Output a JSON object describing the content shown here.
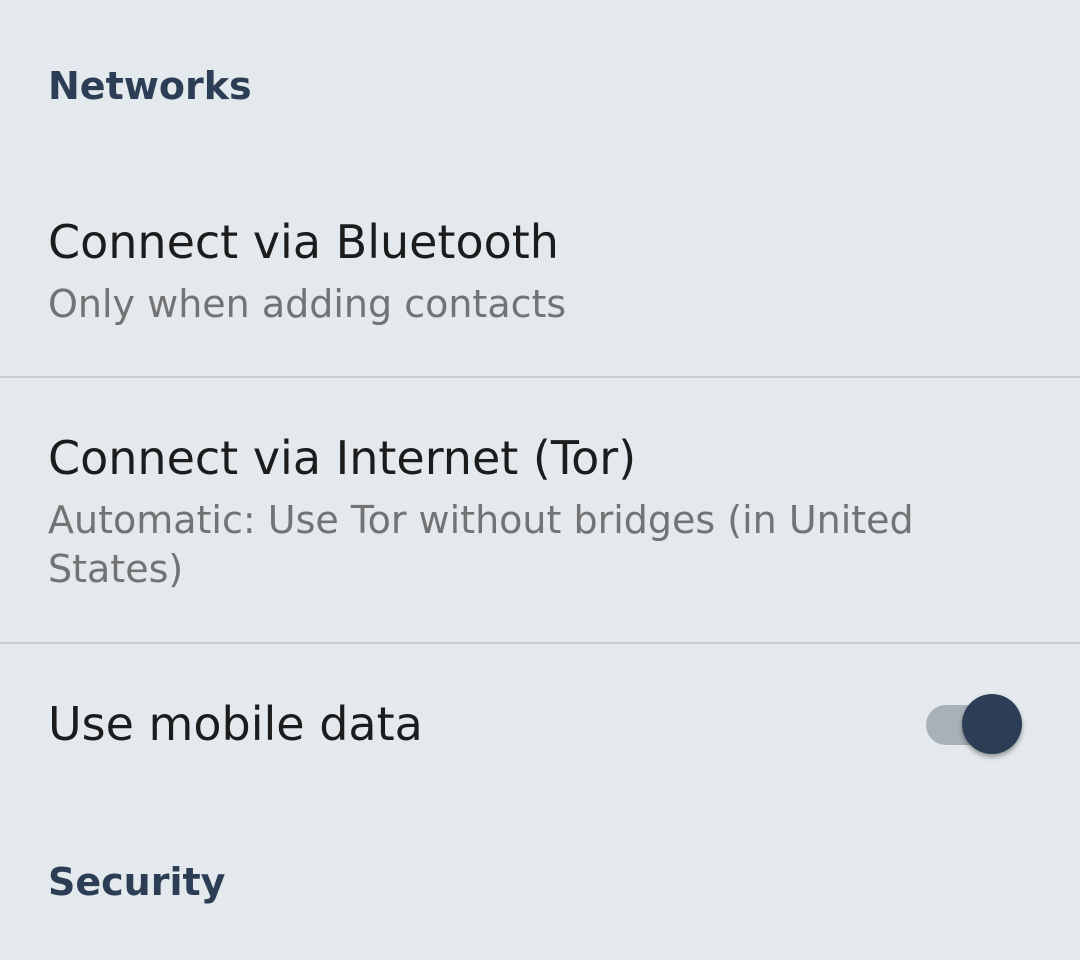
{
  "colors": {
    "background": "#e3e9ec",
    "category_text": "#2c3e55",
    "title_text": "#1c1c1c",
    "summary_text": "#737373",
    "divider": "#c6cccf",
    "switch_thumb": "#2c3e55",
    "switch_track": "#a8b1b9"
  },
  "sections": {
    "networks": {
      "title": "Networks",
      "items": {
        "bluetooth": {
          "title": "Connect via Bluetooth",
          "summary": "Only when adding contacts"
        },
        "tor": {
          "title": "Connect via Internet (Tor)",
          "summary": "Automatic: Use Tor without bridges (in United States)"
        },
        "mobile_data": {
          "title": "Use mobile data",
          "switch_on": true
        }
      }
    },
    "security": {
      "title": "Security"
    }
  }
}
